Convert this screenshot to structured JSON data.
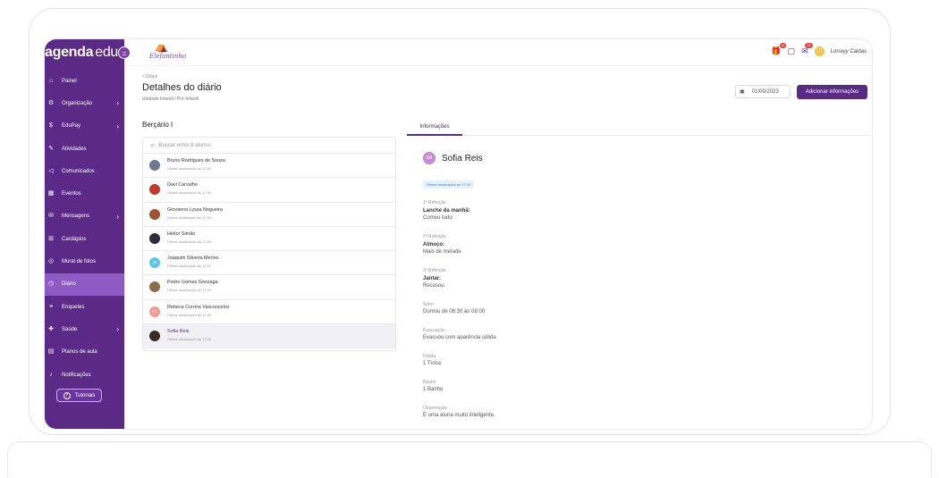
{
  "brand": {
    "bold": "agenda",
    "light": "edu"
  },
  "school": {
    "name": "Elefantinho"
  },
  "topbar": {
    "user_name": "Lorrayy Caldas",
    "user_initials": "LC",
    "badge_gift": "8",
    "badge_chat": "12"
  },
  "sidebar": {
    "items": [
      {
        "label": "Painel",
        "icon": "⌂",
        "chevron": false
      },
      {
        "label": "Organização",
        "icon": "⚙",
        "chevron": true
      },
      {
        "label": "EduPay",
        "icon": "$",
        "chevron": true
      },
      {
        "label": "Atividades",
        "icon": "✎",
        "chevron": false
      },
      {
        "label": "Comunicados",
        "icon": "◁",
        "chevron": false
      },
      {
        "label": "Eventos",
        "icon": "▦",
        "chevron": false
      },
      {
        "label": "Mensagens",
        "icon": "✉",
        "chevron": true
      },
      {
        "label": "Cardápios",
        "icon": "⊞",
        "chevron": false
      },
      {
        "label": "Mural de fotos",
        "icon": "◎",
        "chevron": false
      },
      {
        "label": "Diário",
        "icon": "◷",
        "chevron": false,
        "active": true
      },
      {
        "label": "Enquetes",
        "icon": "≡",
        "chevron": false
      },
      {
        "label": "Saúde",
        "icon": "✚",
        "chevron": true
      },
      {
        "label": "Planos de aula",
        "icon": "▤",
        "chevron": false
      },
      {
        "label": "Notificações",
        "icon": "♪",
        "chevron": false
      }
    ],
    "tutorial_label": "Tutoriais"
  },
  "page": {
    "breadcrumb": "< Diário",
    "title": "Detalhes do diário",
    "subtitle": "Unidade Infantil / Pré-Infantil",
    "date_value": "01/09/2023",
    "add_button": "Adicionar informações"
  },
  "class_title": "Berçário I",
  "search": {
    "placeholder": "Buscar entre 8 alunos"
  },
  "students": [
    {
      "name": "Bruno Rodrigues de Souza",
      "updated": "Última atualização às 17:00",
      "initials": "",
      "color": "#6b7a8f"
    },
    {
      "name": "Davi Carvalho",
      "updated": "Última atualização às 17:00",
      "initials": "",
      "color": "#c0392b"
    },
    {
      "name": "Giovanna Lyssa Nogueira",
      "updated": "Última atualização às 17:00",
      "initials": "",
      "color": "#a0522d"
    },
    {
      "name": "Heitor Simão",
      "updated": "Última atualização às 17:00",
      "initials": "",
      "color": "#2c2c3a"
    },
    {
      "name": "Joaquim Silveira Merino",
      "updated": "Última atualização às 17:00",
      "initials": "JS",
      "color": "#5bc8e6"
    },
    {
      "name": "Pedro Gomes Gonzaga",
      "updated": "Última atualização às 17:00",
      "initials": "",
      "color": "#8a6d4b"
    },
    {
      "name": "Rebeca Correia Vasconcelos",
      "updated": "Última atualização às 17:00",
      "initials": "RC",
      "color": "#f29a8e"
    },
    {
      "name": "Sofia Reis",
      "updated": "Última atualização às 17:00",
      "initials": "",
      "color": "#3a2a20",
      "selected": true
    }
  ],
  "detail": {
    "tab": "Informações",
    "student_initials": "SR",
    "student_name": "Sofia Reis",
    "last_update": "Última atualização às 17:00",
    "sections": [
      {
        "caption": "1ª Refeição",
        "bold": "Lanche da manhã:",
        "value": "Comeu tudo"
      },
      {
        "caption": "2ª Refeição",
        "bold": "Almoço:",
        "value": "Mais de metade"
      },
      {
        "caption": "3ª Refeição",
        "bold": "Jantar:",
        "value": "Recusou"
      },
      {
        "caption": "Sono",
        "bold": "",
        "value": "Dormiu de 08:30 às 09:00"
      },
      {
        "caption": "Evacuação",
        "bold": "",
        "value": "Evacuou com aparência sólida"
      },
      {
        "caption": "Fralda",
        "bold": "",
        "value": "1 Troca"
      },
      {
        "caption": "Banho",
        "bold": "",
        "value": "1 Banho"
      },
      {
        "caption": "Observação",
        "bold": "",
        "value": "É uma aluna muito inteligente."
      }
    ]
  },
  "colors": {
    "brand": "#5b2a86",
    "active": "#8e5bc4"
  }
}
